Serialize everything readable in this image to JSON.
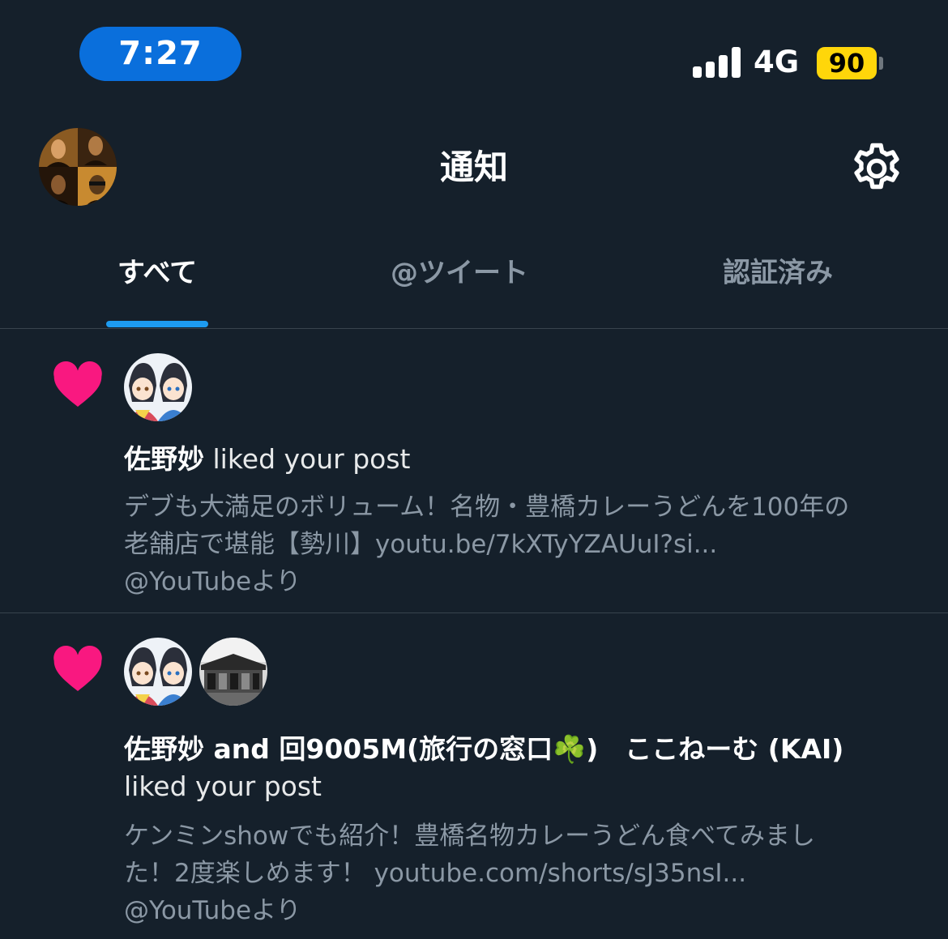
{
  "status_bar": {
    "time": "7:27",
    "network": "4G",
    "battery": "90",
    "signal_icon": "cellular-signal-icon"
  },
  "header": {
    "title": "通知",
    "settings_icon": "gear-icon"
  },
  "tabs": [
    {
      "label": "すべて",
      "active": true
    },
    {
      "label": "@ツイート",
      "active": false
    },
    {
      "label": "認証済み",
      "active": false
    }
  ],
  "notifications": [
    {
      "icon": "heart-icon",
      "actor": "佐野妙",
      "title_rest": " liked your post",
      "body_lines": [
        "デブも大満足のボリューム！名物・豊橋カレーうどんを100年の",
        "老舗店で堪能【勢川】youtu.be/7kXTyYZAUuI?si...",
        "@YouTubeより"
      ]
    },
    {
      "icon": "heart-icon",
      "title_line1": "佐野妙 and 回9005M(旅行の窓口☘️)　ここねーむ (KAI)",
      "title_line2": "liked your post",
      "body_lines": [
        "ケンミンshowでも紹介！豊橋名物カレーうどん食べてみまし",
        "た！2度楽しめます！ youtube.com/shorts/sJ35nsI...",
        "@YouTubeより"
      ]
    }
  ],
  "colors": {
    "background": "#15202b",
    "accent": "#1d9bf0",
    "like": "#f91880",
    "time_pill": "#0a6fdc",
    "battery": "#ffd60a",
    "secondary_text": "#8b98a5"
  }
}
